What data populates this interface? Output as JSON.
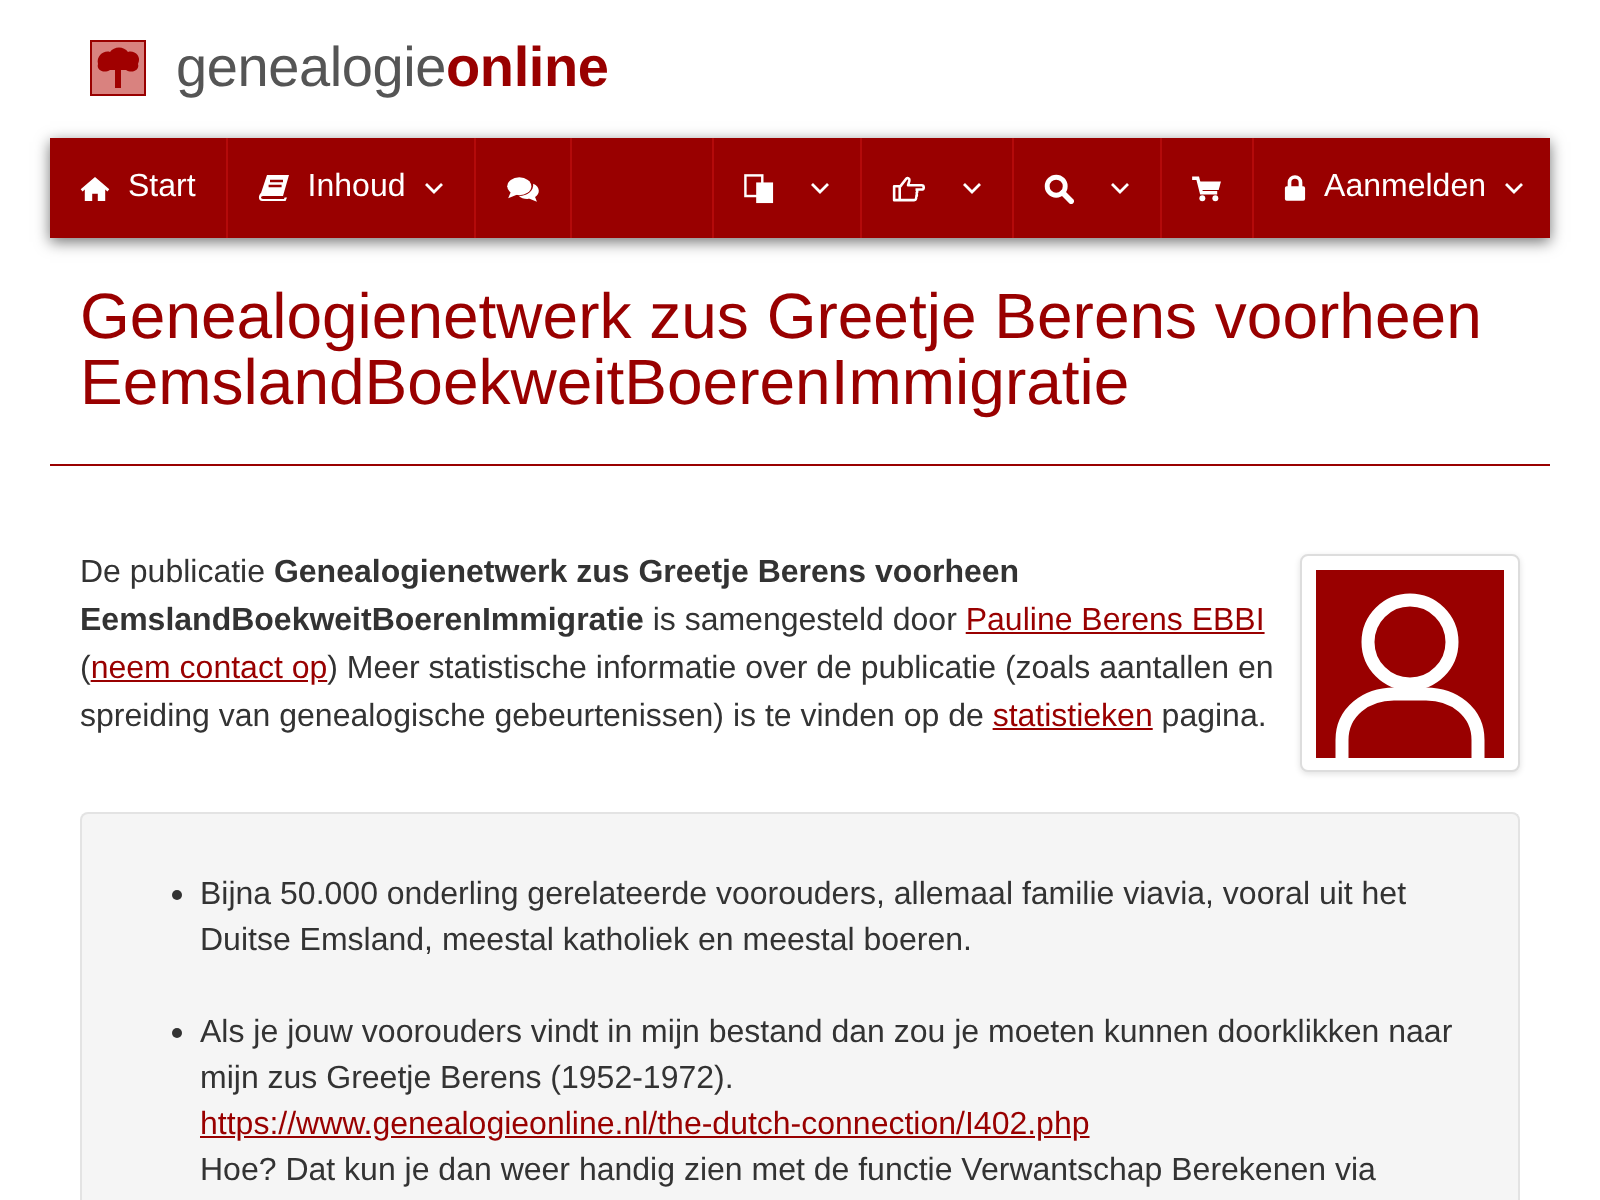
{
  "logo": {
    "text": "genealogie**online**"
  },
  "nav": {
    "left": [
      {
        "label": "Start",
        "dropdown": false
      },
      {
        "label": "Inhoud",
        "dropdown": true
      },
      {
        "dropdown": false
      }
    ],
    "right": [
      {
        "dropdown": true
      },
      {
        "dropdown": true
      },
      {
        "dropdown": true
      },
      {
        "dropdown": false
      },
      {
        "label": "Aanmelden",
        "dropdown": true
      }
    ]
  },
  "title": "Genealogienetwerk zus Greetje Berens voorheen EemslandBoekweitBoerenImmigratie",
  "description": [
    {
      "kind": "text",
      "text": "De publicatie **Genealogienetwerk zus Greetje Berens voorheen EemslandBoekweitBoerenImmigratie** is samengesteld door "
    },
    {
      "kind": "link",
      "text": "Pauline Berens EBBI"
    },
    {
      "kind": "text",
      "text": " ("
    },
    {
      "kind": "link",
      "text": "neem contact op"
    },
    {
      "kind": "text",
      "text": ") Meer statistische informatie over de publicatie (zoals aantallen en spreiding van genealogische gebeurtenissen) is te vinden op de "
    },
    {
      "kind": "link",
      "text": "statistieken"
    },
    {
      "kind": "text",
      "text": " pagina."
    }
  ],
  "highlights": [
    {
      "blocks": [
        {
          "parts": [
            {
              "kind": "text",
              "text": "Bijna 50.000 onderling gerelateerde voorouders, allemaal familie viavia, vooral uit het Duitse Emsland, meestal katholiek en meestal boeren."
            }
          ]
        }
      ]
    },
    {
      "blocks": [
        {
          "parts": [
            {
              "kind": "text",
              "text": "Als je jouw voorouders vindt in mijn bestand dan zou je moeten kunnen doorklikken naar mijn zus Greetje Berens (1952-1972). "
            },
            {
              "kind": "link",
              "text": "https://www.genealogieonline.nl/the-dutch-connection/I402.php"
            }
          ]
        },
        {
          "parts": [
            {
              "kind": "text",
              "text": "Hoe? Dat kun je dan weer handig zien met de functie Verwantschap Berekenen via"
            }
          ]
        }
      ]
    }
  ]
}
